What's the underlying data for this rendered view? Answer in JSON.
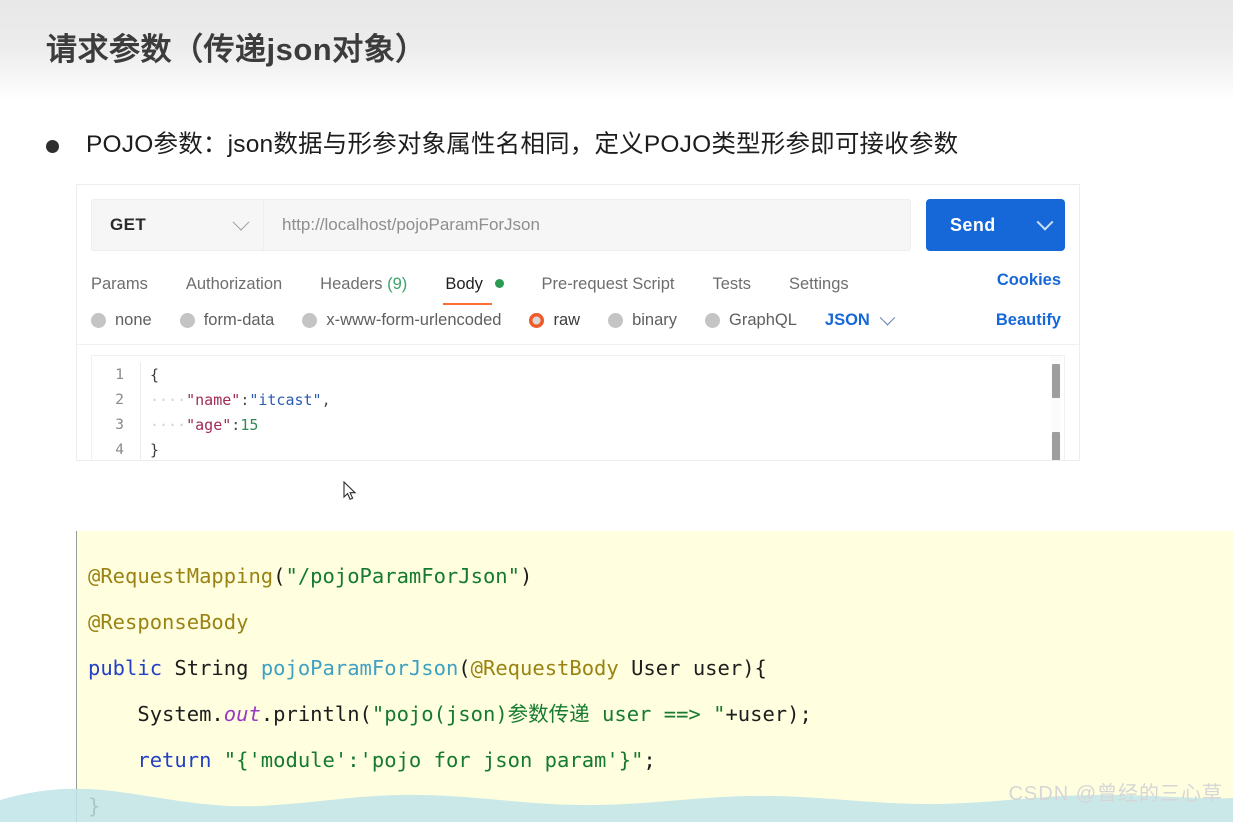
{
  "slide": {
    "title": "请求参数（传递json对象）",
    "bullet": "POJO参数：json数据与形参对象属性名相同，定义POJO类型形参即可接收参数"
  },
  "postman": {
    "method": "GET",
    "url": "http://localhost/pojoParamForJson",
    "send_label": "Send",
    "tabs": [
      {
        "label": "Params",
        "active": false
      },
      {
        "label": "Authorization",
        "active": false
      },
      {
        "label": "Headers",
        "count": "(9)",
        "active": false
      },
      {
        "label": "Body",
        "active": true,
        "has_dot": true
      },
      {
        "label": "Pre-request Script",
        "active": false
      },
      {
        "label": "Tests",
        "active": false
      },
      {
        "label": "Settings",
        "active": false
      }
    ],
    "cookies_label": "Cookies",
    "body_types": [
      {
        "label": "none",
        "selected": false
      },
      {
        "label": "form-data",
        "selected": false
      },
      {
        "label": "x-www-form-urlencoded",
        "selected": false
      },
      {
        "label": "raw",
        "selected": true
      },
      {
        "label": "binary",
        "selected": false
      },
      {
        "label": "GraphQL",
        "selected": false
      }
    ],
    "format_label": "JSON",
    "beautify_label": "Beautify",
    "editor": {
      "lines": [
        {
          "num": "1",
          "indent": "",
          "text": "{"
        },
        {
          "num": "2",
          "indent": "····",
          "key": "\"name\"",
          "colon": ":",
          "value": "\"itcast\"",
          "tail": ","
        },
        {
          "num": "3",
          "indent": "····",
          "key": "\"age\"",
          "colon": ":",
          "num_value": "15",
          "tail": ""
        },
        {
          "num": "4",
          "indent": "",
          "text": "}"
        }
      ]
    }
  },
  "code": {
    "line1": {
      "ann": "@RequestMapping",
      "open": "(",
      "str": "\"/pojoParamForJson\"",
      "close": ")"
    },
    "line2": {
      "ann": "@ResponseBody"
    },
    "line3": {
      "kw": "public",
      "sp1": " ",
      "type": "String",
      "sp2": " ",
      "meth": "pojoParamForJson",
      "open": "(",
      "ann": "@RequestBody",
      "sp3": " ",
      "param_type": "User",
      "sp4": " ",
      "param": "user",
      "close": "){"
    },
    "line4": {
      "indent": "    ",
      "pre": "System.",
      "field": "out",
      "mid": ".println(",
      "str": "\"pojo(json)参数传递 user ==> \"",
      "post": "+user);"
    },
    "line5": {
      "indent": "    ",
      "kw": "return",
      "sp": " ",
      "str": "\"{'module':'pojo for json param'}\"",
      "post": ";"
    },
    "line6": {
      "text": "}"
    }
  },
  "watermark": "CSDN @曾经的三心草",
  "colors": {
    "accent_orange": "#ff6c37",
    "send_blue": "#1668d8",
    "code_bg": "#ffffe0",
    "wave_blue": "#bfe4e8"
  }
}
